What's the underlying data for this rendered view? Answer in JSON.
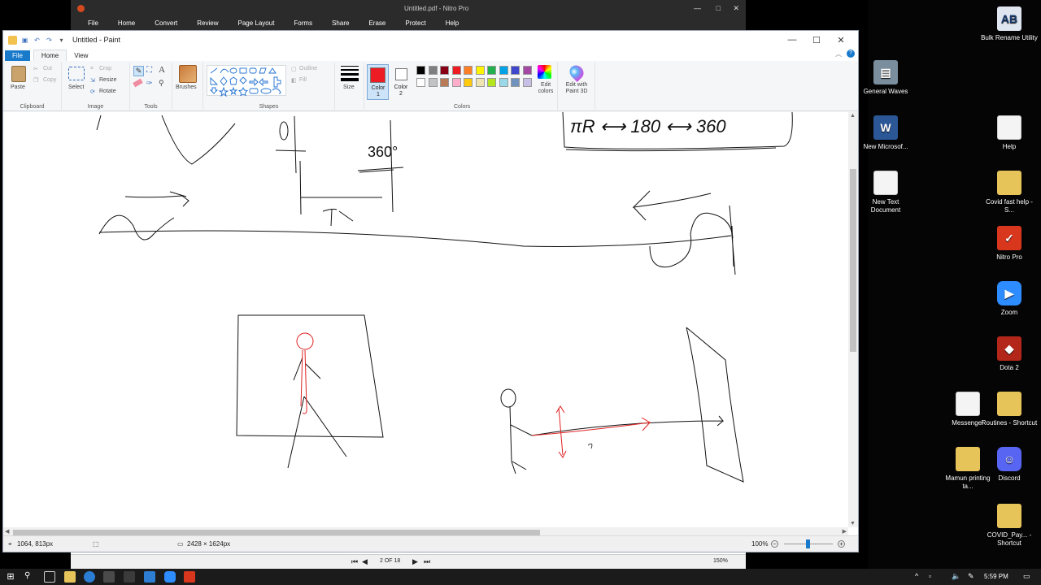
{
  "nitro": {
    "title": "Untitled.pdf - Nitro Pro",
    "menu": [
      "File",
      "Home",
      "Convert",
      "Review",
      "Page Layout",
      "Forms",
      "Share",
      "Erase",
      "Protect",
      "Help"
    ],
    "page_indicator": "2 OF 18",
    "zoom": "150%"
  },
  "paint": {
    "title": "Untitled - Paint",
    "tabs": [
      "File",
      "Home",
      "View"
    ],
    "clipboard": {
      "paste": "Paste",
      "cut": "Cut",
      "copy": "Copy",
      "label": "Clipboard"
    },
    "image": {
      "select": "Select",
      "crop": "Crop",
      "resize": "Resize",
      "rotate": "Rotate",
      "label": "Image"
    },
    "tools": {
      "label": "Tools"
    },
    "brushes": "Brushes",
    "shapes": {
      "outline": "Outline",
      "fill": "Fill",
      "label": "Shapes"
    },
    "size": "Size",
    "color1": "Color 1",
    "color2": "Color 2",
    "colors_label": "Colors",
    "edit_colors": "Edit colors",
    "edit_paint3d": "Edit with Paint 3D",
    "palette_row1": [
      "#000000",
      "#7f7f7f",
      "#880015",
      "#ed1c24",
      "#ff7f27",
      "#fff200",
      "#22b14c",
      "#00a2e8",
      "#3f48cc",
      "#a349a4"
    ],
    "palette_row2": [
      "#ffffff",
      "#c3c3c3",
      "#b97a57",
      "#ffaec9",
      "#ffc90e",
      "#efe4b0",
      "#b5e61d",
      "#99d9ea",
      "#7092be",
      "#c8bfe7"
    ],
    "status": {
      "cursor": "1064, 813px",
      "dimensions": "2428 × 1624px",
      "zoom": "100%"
    },
    "canvas_text": {
      "ratio": "πR ⟷ 180 ⟷ 360",
      "angle": "360°",
      "zero": "0"
    }
  },
  "desktop_icons": [
    {
      "label": "Bulk Rename Utility",
      "icon": "bulk-rename-icon"
    },
    {
      "label": "General Waves",
      "icon": "winrar-icon"
    },
    {
      "label": "New Microsof...",
      "icon": "word-icon"
    },
    {
      "label": "Help",
      "icon": "document-icon"
    },
    {
      "label": "New Text Document",
      "icon": "text-document-icon"
    },
    {
      "label": "Covid fast help - S...",
      "icon": "shortcut-icon"
    },
    {
      "label": "Nitro Pro",
      "icon": "nitro-icon"
    },
    {
      "label": "Zoom",
      "icon": "zoom-icon"
    },
    {
      "label": "Dota 2",
      "icon": "dota-icon"
    },
    {
      "label": "Messenger",
      "icon": "document-icon"
    },
    {
      "label": "Routines - Shortcut",
      "icon": "shortcut-icon"
    },
    {
      "label": "Mamun printing ta...",
      "icon": "folder-icon"
    },
    {
      "label": "Discord",
      "icon": "discord-icon"
    },
    {
      "label": "COVID_Pay... - Shortcut",
      "icon": "shortcut-icon"
    }
  ],
  "taskbar": {
    "time": "5:59 PM"
  }
}
